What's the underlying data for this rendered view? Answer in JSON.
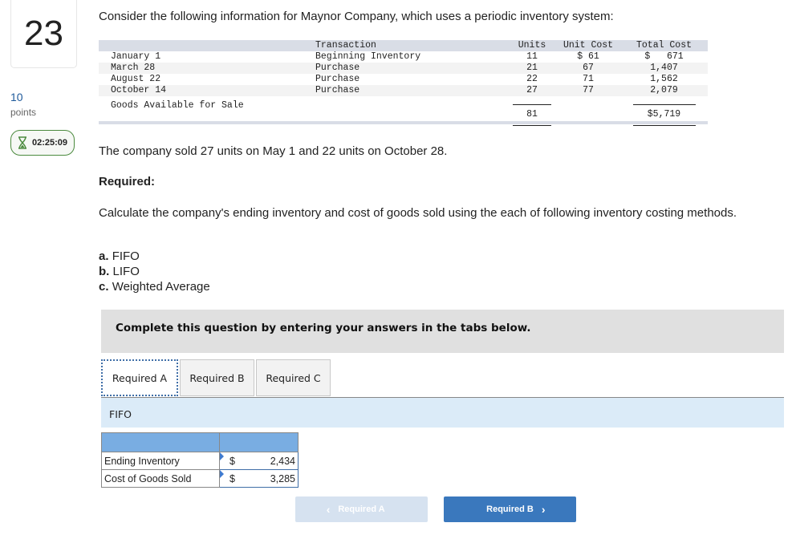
{
  "question": {
    "number": "23",
    "points_value": "10",
    "points_label": "points",
    "timer": "02:25:09",
    "timer_icon": "hourglass-icon"
  },
  "intro": "Consider the following information for Maynor Company, which uses a periodic inventory system:",
  "inventory_table": {
    "headers": {
      "date": "",
      "transaction": "Transaction",
      "units": "Units",
      "unit_cost": "Unit Cost",
      "total_cost": "Total Cost"
    },
    "rows": [
      {
        "date": "January 1",
        "transaction": "Beginning Inventory",
        "units": "11",
        "unit_cost": "$ 61",
        "total_cost": "$   671"
      },
      {
        "date": "March 28",
        "transaction": "Purchase",
        "units": "21",
        "unit_cost": "67",
        "total_cost": "1,407"
      },
      {
        "date": "August 22",
        "transaction": "Purchase",
        "units": "22",
        "unit_cost": "71",
        "total_cost": "1,562"
      },
      {
        "date": "October 14",
        "transaction": "Purchase",
        "units": "27",
        "unit_cost": "77",
        "total_cost": "2,079"
      }
    ],
    "total": {
      "label": "Goods Available for Sale",
      "units": "81",
      "total_cost": "$5,719"
    }
  },
  "sales_text": "The company sold 27 units on May 1 and 22 units on October 28.",
  "required_label": "Required:",
  "calc_text": "Calculate the company's ending inventory and cost of goods sold using the each of following inventory costing methods.",
  "methods": [
    {
      "letter": "a.",
      "name": "FIFO"
    },
    {
      "letter": "b.",
      "name": "LIFO"
    },
    {
      "letter": "c.",
      "name": "Weighted Average"
    }
  ],
  "instructions": "Complete this question by entering your answers in the tabs below.",
  "tabs": [
    {
      "label": "Required A",
      "active": true
    },
    {
      "label": "Required B",
      "active": false
    },
    {
      "label": "Required C",
      "active": false
    }
  ],
  "panel_title": "FIFO",
  "answer_table": {
    "rows": [
      {
        "label": "Ending Inventory",
        "currency": "$",
        "value": "2,434"
      },
      {
        "label": "Cost of Goods Sold",
        "currency": "$",
        "value": "3,285"
      }
    ]
  },
  "nav": {
    "prev_label": "Required A",
    "next_label": "Required B",
    "prev_icon": "chevron-left-icon",
    "next_icon": "chevron-right-icon"
  },
  "colors": {
    "accent": "#3a78bd",
    "timer_border": "#4b8a3e",
    "points": "#1f5a9b",
    "answer_header": "#79ade2",
    "subheader_bg": "#dbebf8"
  }
}
